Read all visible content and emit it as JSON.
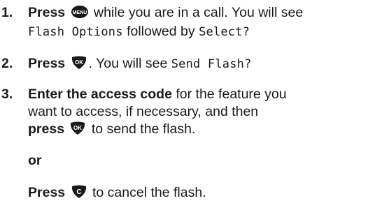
{
  "steps": [
    {
      "number": "1.",
      "bold": "Press",
      "after_icon": "while you are in a call. You will see",
      "lcd1": "Flash Options",
      "mid": "followed by",
      "lcd2": "Select?"
    },
    {
      "number": "2.",
      "bold": "Press",
      "after_icon": ". You will see",
      "lcd1": "Send Flash?"
    },
    {
      "number": "3.",
      "bold": "Enter the access code",
      "text1": "for the feature you",
      "text2": "want to access, if necessary, and then",
      "bold2": "press",
      "after_icon": "to send the flash."
    }
  ],
  "or_label": "or",
  "final": {
    "bold": "Press",
    "after_icon": "to cancel the flash."
  },
  "icons": {
    "menu": "menu-key-icon",
    "ok": "ok-key-icon",
    "clear": "clear-key-icon"
  },
  "colors": {
    "text": "#1a1a1a",
    "key_fill": "#1a1a1a",
    "key_text": "#ffffff"
  }
}
